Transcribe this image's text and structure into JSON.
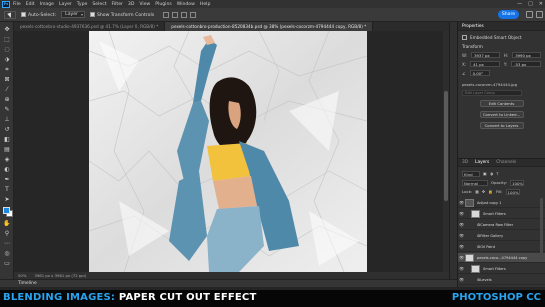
{
  "app": {
    "logo_text": "Ps"
  },
  "menu": [
    "File",
    "Edit",
    "Image",
    "Layer",
    "Type",
    "Select",
    "Filter",
    "3D",
    "View",
    "Plugins",
    "Window",
    "Help"
  ],
  "window_controls": [
    "—",
    "□",
    "✕"
  ],
  "options_bar": {
    "auto_select_label": "Auto-Select:",
    "auto_select_value": "Layer",
    "show_transform_label": "Show Transform Controls",
    "share_label": "Share"
  },
  "tabs": [
    {
      "label": "pexels-cottonbro-studio-4937636.psd @ 41.7% (Layer 0, RGB/8) *",
      "active": false
    },
    {
      "label": "pexels-cottonbro-production-8520834b.psd @ 38% (pexels-cocorzm-4794444 copy, RGB/8) *",
      "active": true
    }
  ],
  "status": {
    "zoom": "50%",
    "doc_size": "3981 px x 3961 px (72 ppi)"
  },
  "timeline_label": "Timeline",
  "properties": {
    "tabs": [
      "Properties"
    ],
    "header": "Embedded Smart Object",
    "transform_label": "Transform",
    "w_label": "W:",
    "w_value": "3937 px",
    "h_label": "H:",
    "h_value": "3990 px",
    "x_label": "X:",
    "x_value": "41 px",
    "y_label": "Y:",
    "y_value": "-53 px",
    "angle_value": "0.00°",
    "filename": "pexels-cocorzm-4794444.jpg",
    "edit_placeholder": "Edit Layer Comp",
    "buttons": [
      "Edit Contents",
      "Convert to Linked...",
      "Convert to Layers"
    ]
  },
  "layers_panel": {
    "tabs": [
      "3D",
      "Layers",
      "Channels"
    ],
    "kind_label": "Kind",
    "blend_mode": "Normal",
    "opacity_label": "Opacity:",
    "opacity_value": "100%",
    "lock_label": "Lock:",
    "fill_label": "Fill:",
    "fill_value": "100%",
    "layers": [
      {
        "name": "Adjust copy 1",
        "eye": true,
        "selected": false,
        "thumb": "dark",
        "indent": 0
      },
      {
        "name": "Smart Filters",
        "eye": true,
        "selected": false,
        "thumb": "light",
        "indent": 1
      },
      {
        "name": "Camera Raw Filter",
        "eye": true,
        "selected": false,
        "thumb": "none",
        "indent": 2
      },
      {
        "name": "Filter Gallery",
        "eye": true,
        "selected": false,
        "thumb": "none",
        "indent": 2
      },
      {
        "name": "Oil Paint",
        "eye": true,
        "selected": false,
        "thumb": "none",
        "indent": 2
      },
      {
        "name": "pexels-coco...4794444 copy",
        "eye": true,
        "selected": true,
        "thumb": "light",
        "indent": 0
      },
      {
        "name": "Smart Filters",
        "eye": true,
        "selected": false,
        "thumb": "light",
        "indent": 1
      },
      {
        "name": "Levels",
        "eye": true,
        "selected": false,
        "thumb": "none",
        "indent": 2
      }
    ]
  },
  "caption": {
    "left_blue": "BLENDING IMAGES:",
    "left_white": "PAPER CUT OUT EFFECT",
    "right": "PHOTOSHOP CC"
  },
  "colors": {
    "accent": "#29a4f0",
    "share_button": "#1473e6",
    "foreground_swatch": "#1e88e5",
    "background_swatch": "#ffffff",
    "shirt": "#f2c23c",
    "denim": "#5c93b0"
  }
}
